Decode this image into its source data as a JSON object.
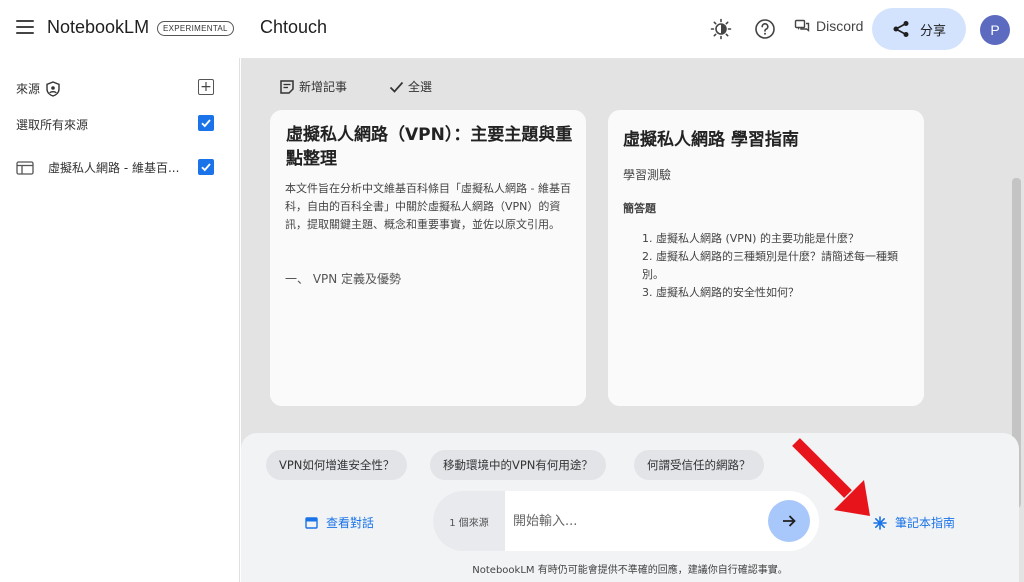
{
  "app": {
    "name": "NotebookLM",
    "badge": "EXPERIMENTAL"
  },
  "notebook": {
    "title": "Chtouch"
  },
  "header": {
    "discord_label": "Discord",
    "share_label": "分享",
    "avatar_letter": "P"
  },
  "sidebar": {
    "sources_label": "來源",
    "select_all_label": "選取所有來源",
    "sources": [
      {
        "label": "虛擬私人網路 - 維基百..."
      }
    ]
  },
  "toolbar": {
    "add_note_label": "新增記事",
    "select_all_label": "全選"
  },
  "cards": [
    {
      "title": "虛擬私人網路（VPN）：主要主題與重點整理",
      "body": "本文件旨在分析中文維基百科條目「虛擬私人網路 - 維基百科，自由的百科全書」中關於虛擬私人網路（VPN）的資訊，提取關鍵主題、概念和重要事實，並佐以原文引用。",
      "section": "一、 VPN 定義及優勢"
    },
    {
      "title": "虛擬私人網路 學習指南",
      "subtitle": "學習測驗",
      "section": "簡答題",
      "items": [
        "1. 虛擬私人網路 (VPN) 的主要功能是什麼？",
        "2. 虛擬私人網路的三種類別是什麼？請簡述每一種類別。",
        "3. 虛擬私人網路的安全性如何？"
      ]
    }
  ],
  "chat": {
    "suggestions": [
      "VPN如何增進安全性？",
      "移動環境中的VPN有何用途？",
      "何謂受信任的網路？"
    ],
    "view_chat_label": "查看對話",
    "source_count": "1 個來源",
    "input_placeholder": "開始輸入...",
    "notebook_guide_label": "筆記本指南",
    "disclaimer": "NotebookLM 有時仍可能會提供不準確的回應，建議你自行確認事實。"
  },
  "colors": {
    "accent": "#1a73e8",
    "share_bg": "#d3e3fd",
    "avatar": "#5c6bc0",
    "annotation_arrow": "#e8141b"
  }
}
